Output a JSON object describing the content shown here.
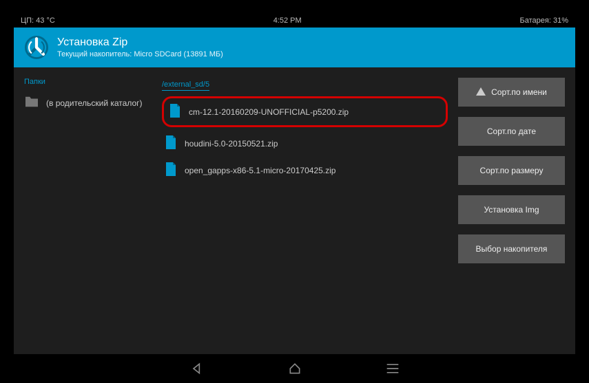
{
  "statusbar": {
    "left": "ЦП: 43 °C",
    "center": "4:52 PM",
    "right": "Батарея: 31%"
  },
  "header": {
    "title": "Установка Zip",
    "subtitle": "Текущий накопитель: Micro SDCard (13891 МБ)"
  },
  "folders": {
    "label": "Папки",
    "items": [
      "(в родительский каталог)"
    ]
  },
  "files": {
    "path": "/external_sd/5",
    "items": [
      "cm-12.1-20160209-UNOFFICIAL-p5200.zip",
      "houdini-5.0-20150521.zip",
      "open_gapps-x86-5.1-micro-20170425.zip"
    ]
  },
  "actions": {
    "sort_name": "Сорт.по имени",
    "sort_date": "Сорт.по дате",
    "sort_size": "Сорт.по размеру",
    "install_img": "Установка Img",
    "select_storage": "Выбор накопителя"
  }
}
